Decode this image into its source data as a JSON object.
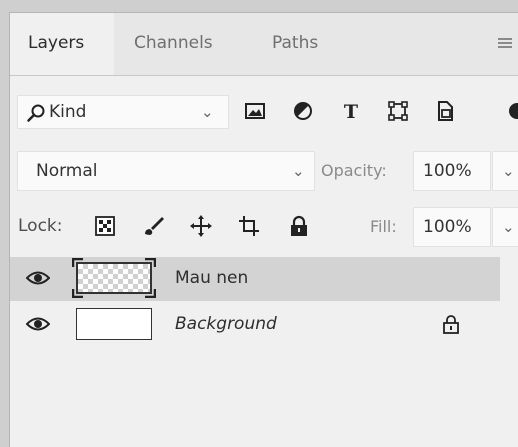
{
  "tabs": [
    {
      "label": "Layers",
      "active": true
    },
    {
      "label": "Channels",
      "active": false
    },
    {
      "label": "Paths",
      "active": false
    }
  ],
  "filter": {
    "kind_label": "Kind",
    "icons": [
      "image-filter-icon",
      "adjustment-filter-icon",
      "type-filter-icon",
      "shape-filter-icon",
      "smart-object-filter-icon",
      "filter-toggle-icon"
    ]
  },
  "blend": {
    "mode": "Normal",
    "opacity_label": "Opacity:",
    "opacity_value": "100%"
  },
  "lock": {
    "label": "Lock:",
    "icons": [
      "lock-transparent-pixels-icon",
      "lock-image-pixels-icon",
      "lock-position-icon",
      "lock-artboard-icon",
      "lock-all-icon"
    ],
    "fill_label": "Fill:",
    "fill_value": "100%"
  },
  "layers": [
    {
      "name": "Mau nen",
      "visible": true,
      "selected": true,
      "transparent": true,
      "locked": false,
      "italic": false
    },
    {
      "name": "Background",
      "visible": true,
      "selected": false,
      "transparent": false,
      "locked": true,
      "italic": true
    }
  ],
  "colors": {
    "panel_bg": "#f0f0f0",
    "selected_layer": "#d3d3d3",
    "tab_inactive_text": "#6f6f6f"
  }
}
